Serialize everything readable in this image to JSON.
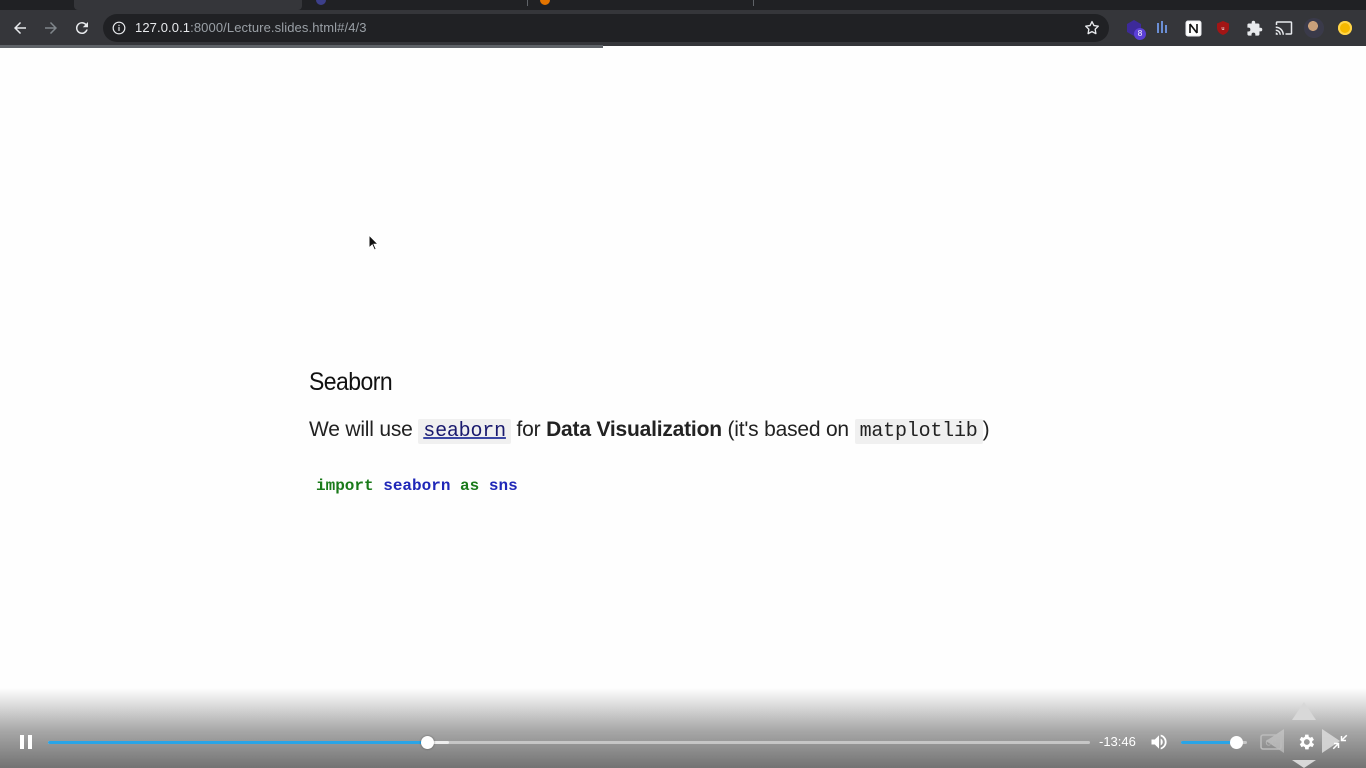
{
  "browser": {
    "url_host": "127.0.0.1",
    "url_rest": ":8000/Lecture.slides.html#/4/3",
    "extension_badge": "8"
  },
  "slide": {
    "title": "Seaborn",
    "text_before": "We will use",
    "code_seaborn": "seaborn",
    "text_for": "for",
    "text_bold": "Data Visualization",
    "text_based": "(it's based on",
    "code_matplotlib": "matplotlib",
    "text_close": ")",
    "code": {
      "kw_import": "import",
      "module": "seaborn",
      "kw_as": "as",
      "alias": "sns"
    }
  },
  "video": {
    "time_remaining": "-13:46",
    "progress": 0.364,
    "buffered": 0.385,
    "volume": 0.83,
    "accent_color": "#2aa4e6"
  },
  "icons": [
    "back-icon",
    "forward-icon",
    "reload-icon",
    "info-icon",
    "star-icon",
    "puzzle-icon",
    "cast-icon",
    "pause-icon",
    "volume-icon",
    "captions-icon",
    "gear-icon",
    "exit-fullscreen-icon"
  ]
}
